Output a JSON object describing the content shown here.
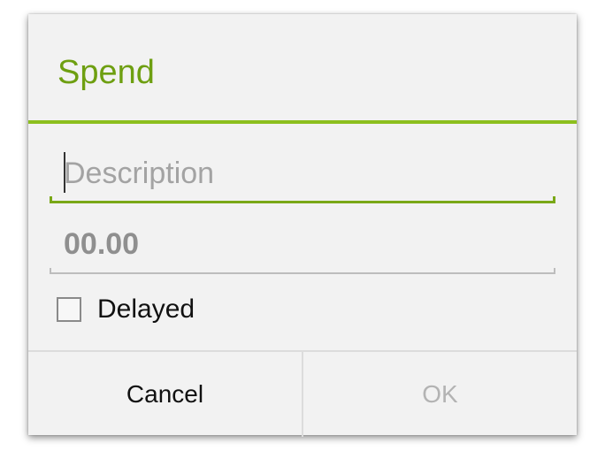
{
  "dialog": {
    "title": "Spend",
    "accent_color": "#8cbf1e",
    "title_color": "#6e9f11"
  },
  "fields": {
    "description": {
      "placeholder": "Description",
      "value": ""
    },
    "amount": {
      "placeholder": "00.00",
      "value": ""
    }
  },
  "delayed": {
    "label": "Delayed",
    "checked": false
  },
  "buttons": {
    "cancel_label": "Cancel",
    "ok_label": "OK",
    "ok_enabled": false
  }
}
